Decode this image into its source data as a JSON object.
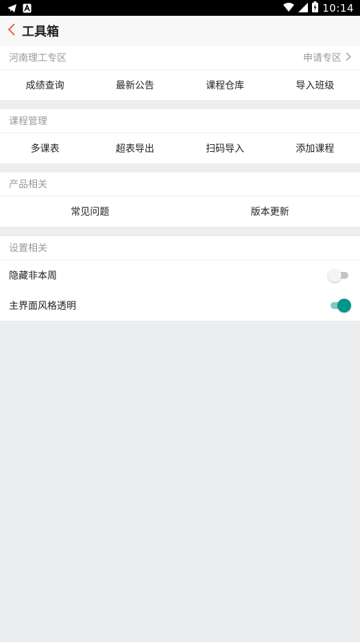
{
  "status_bar": {
    "time": "10:14",
    "icons_left": [
      "telegram-icon",
      "a-notification-icon"
    ],
    "icons_right": [
      "wifi-icon",
      "signal-icon",
      "battery-icon"
    ]
  },
  "header": {
    "title": "工具箱",
    "back_icon": "chevron-left-icon",
    "accent_color": "#e8643c"
  },
  "sections": {
    "henan": {
      "title": "河南理工专区",
      "action_label": "申请专区",
      "items": [
        "成绩查询",
        "最新公告",
        "课程仓库",
        "导入班级"
      ]
    },
    "course": {
      "title": "课程管理",
      "items": [
        "多课表",
        "超表导出",
        "扫码导入",
        "添加课程"
      ]
    },
    "product": {
      "title": "产品相关",
      "items": [
        "常见问题",
        "版本更新"
      ]
    },
    "settings": {
      "title": "设置相关",
      "hide_non_week": {
        "label": "隐藏非本周",
        "enabled": false
      },
      "transparent_style": {
        "label": "主界面风格透明",
        "enabled": true
      },
      "toggle_on_color": "#009688"
    }
  }
}
